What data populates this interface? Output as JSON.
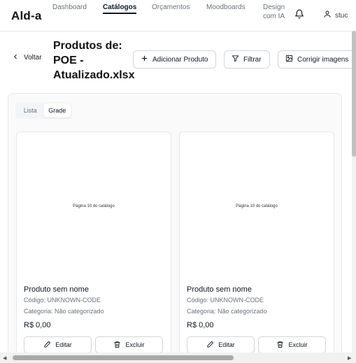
{
  "app": {
    "logo": "Ald-a"
  },
  "nav": {
    "items": [
      {
        "label": "Dashboard"
      },
      {
        "label": "Catálogos"
      },
      {
        "label": "Orçamentos"
      },
      {
        "label": "Moodboards"
      },
      {
        "label": "Design com IA"
      }
    ],
    "active": "Catálogos",
    "user_label": "stuc"
  },
  "header": {
    "back_label": "Voltar",
    "title": "Produtos de: POE - Atualizado.xlsx",
    "add_label": "Adicionar Produto",
    "filter_label": "Filtrar",
    "fix_images_label": "Corrigir imagens"
  },
  "view_toggle": {
    "options": [
      "Lista",
      "Grade"
    ],
    "selected": "Grade"
  },
  "products": [
    {
      "image_text": "Página 10 do catálogo",
      "name": "Produto sem nome",
      "code": "Código: UNKNOWN-CODE",
      "category": "Categoria: Não categorizado",
      "price": "R$ 0,00",
      "edit_label": "Editar",
      "delete_label": "Excluir"
    },
    {
      "image_text": "Página 10 do catálogo",
      "name": "Produto sem nome",
      "code": "Código: UNKNOWN-CODE",
      "category": "Categoria: Não categorizado",
      "price": "R$ 0,00",
      "edit_label": "Editar",
      "delete_label": "Excluir"
    }
  ],
  "icons": {
    "bell": "bell-icon",
    "user": "user-icon",
    "back": "chevron-left-icon",
    "add": "plus-icon",
    "filter": "filter-icon",
    "fix": "image-icon",
    "edit": "pencil-icon",
    "delete": "trash-icon"
  }
}
